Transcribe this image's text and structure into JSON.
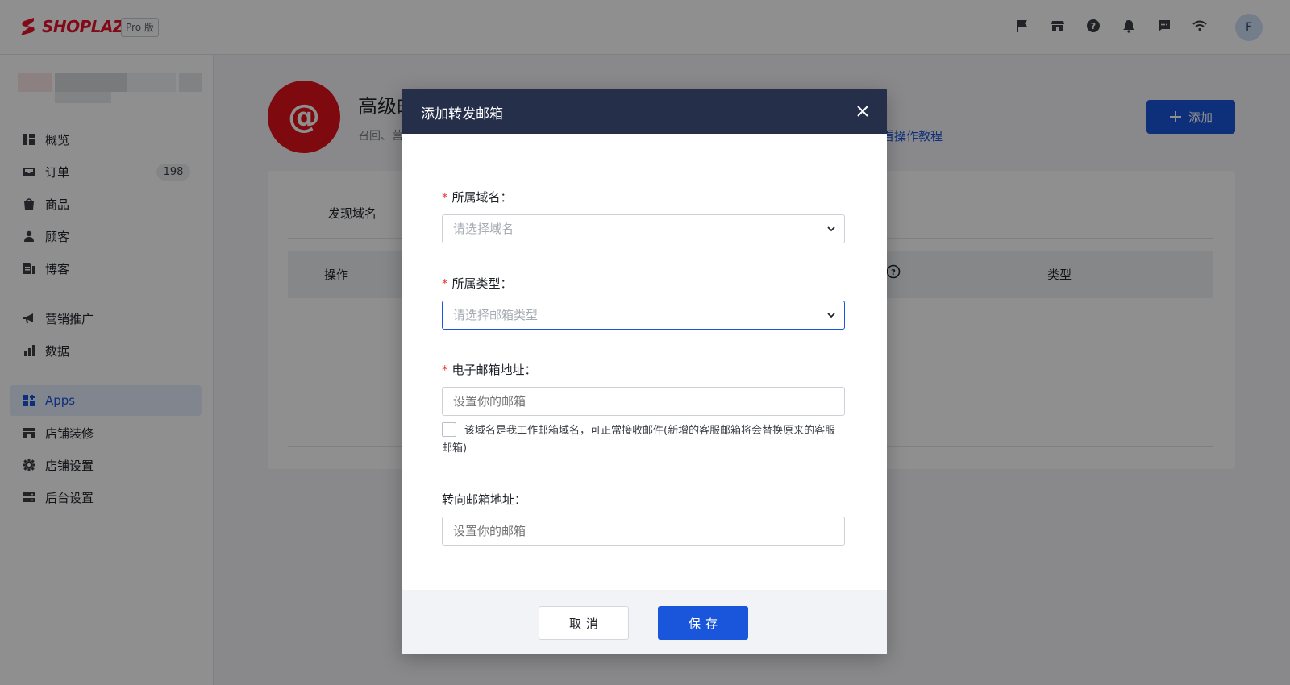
{
  "header": {
    "logo_text": "SHOPLAZZA",
    "plan_badge": "Pro 版",
    "avatar_initial": "F",
    "icons": [
      "flag-icon",
      "store-icon",
      "help-icon",
      "bell-icon",
      "chat-icon",
      "wifi-icon"
    ]
  },
  "sidebar": {
    "items": [
      {
        "label": "概览",
        "icon": "dashboard-icon"
      },
      {
        "label": "订单",
        "icon": "inbox-icon",
        "badge": "198"
      },
      {
        "label": "商品",
        "icon": "bag-icon"
      },
      {
        "label": "顾客",
        "icon": "person-icon"
      },
      {
        "label": "博客",
        "icon": "blog-icon"
      },
      {
        "label": "营销推广",
        "icon": "megaphone-icon"
      },
      {
        "label": "数据",
        "icon": "bar-chart-icon"
      },
      {
        "label": "Apps",
        "icon": "apps-icon",
        "active": true
      },
      {
        "label": "店铺装修",
        "icon": "store-icon"
      },
      {
        "label": "店铺设置",
        "icon": "gear-icon"
      },
      {
        "label": "后台设置",
        "icon": "server-icon"
      }
    ]
  },
  "main": {
    "avatar_symbol": "@",
    "title": "高级邮",
    "subtitle": "召回、营",
    "tutorial_link": "看操作教程",
    "add_button": "添加",
    "tab": "发现域名",
    "table_headers": [
      "操作",
      "类型"
    ]
  },
  "modal": {
    "title": "添加转发邮箱",
    "domain": {
      "label": "所属域名：",
      "placeholder": "请选择域名"
    },
    "type": {
      "label": "所属类型：",
      "placeholder": "请选择邮箱类型"
    },
    "email": {
      "label": "电子邮箱地址：",
      "placeholder": "设置你的邮箱"
    },
    "checkbox_text": "该域名是我工作邮箱域名，可正常接收邮件(新增的客服邮箱将会替换原来的客服邮箱)",
    "forward": {
      "label": "转向邮箱地址：",
      "placeholder": "设置你的邮箱"
    },
    "cancel_label": "取消",
    "save_label": "保存"
  },
  "colors": {
    "brand_red": "#e8132b",
    "primary_blue": "#1a56db",
    "modal_header": "#252f4a"
  }
}
